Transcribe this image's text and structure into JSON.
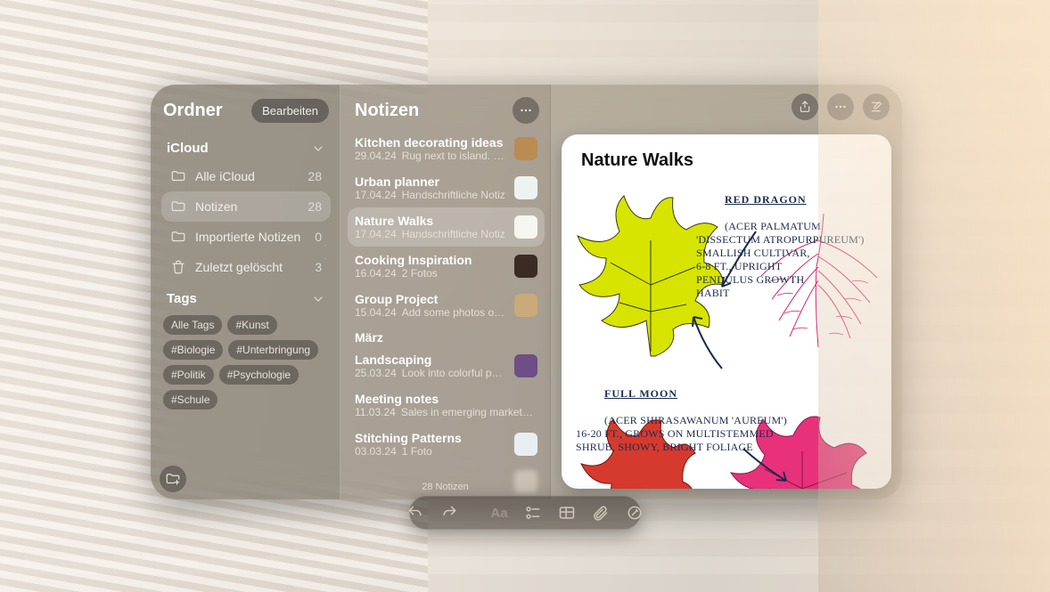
{
  "sidebar": {
    "title": "Ordner",
    "edit_label": "Bearbeiten",
    "section_label": "iCloud",
    "folders": [
      {
        "icon": "folder",
        "label": "Alle iCloud",
        "count": "28",
        "selected": false
      },
      {
        "icon": "folder",
        "label": "Notizen",
        "count": "28",
        "selected": true
      },
      {
        "icon": "folder",
        "label": "Importierte Notizen",
        "count": "0",
        "selected": false
      },
      {
        "icon": "trash",
        "label": "Zuletzt gelöscht",
        "count": "3",
        "selected": false
      }
    ],
    "tags_label": "Tags",
    "tags": [
      "Alle Tags",
      "#Kunst",
      "#Biologie",
      "#Unterbringung",
      "#Politik",
      "#Psychologie",
      "#Schule"
    ]
  },
  "mid": {
    "title": "Notizen",
    "sections": [
      {
        "label": null,
        "notes": [
          {
            "title": "Kitchen decorating ideas",
            "date": "29.04.24",
            "preview": "Rug next to island. Cont…",
            "thumb": "#b98c54",
            "selected": false
          },
          {
            "title": "Urban planner",
            "date": "17.04.24",
            "preview": "Handschriftliche Notiz",
            "thumb": "#eef2f1",
            "selected": false
          },
          {
            "title": "Nature Walks",
            "date": "17.04.24",
            "preview": "Handschriftliche Notiz",
            "thumb": "#f6f6f0",
            "selected": true
          },
          {
            "title": "Cooking Inspiration",
            "date": "16.04.24",
            "preview": "2 Fotos",
            "thumb": "#3b2b22",
            "selected": false
          },
          {
            "title": "Group Project",
            "date": "15.04.24",
            "preview": "Add some photos of thei…",
            "thumb": "#caa97a",
            "selected": false
          }
        ]
      },
      {
        "label": "März",
        "notes": [
          {
            "title": "Landscaping",
            "date": "25.03.24",
            "preview": "Look into colorful peren…",
            "thumb": "#6e4e86",
            "selected": false
          },
          {
            "title": "Meeting notes",
            "date": "11.03.24",
            "preview": "Sales in emerging markets are tr…",
            "thumb": null,
            "selected": false
          },
          {
            "title": "Stitching Patterns",
            "date": "03.03.24",
            "preview": "1 Foto",
            "thumb": "#e9eef2",
            "selected": false
          },
          {
            "title": "",
            "date": "",
            "preview": "",
            "thumb": "#d8cfc1",
            "selected": false,
            "blur": true
          }
        ]
      }
    ],
    "footer": "28 Notizen"
  },
  "detail": {
    "title": "Nature Walks",
    "annotations": {
      "a": "RED DRAGON\n(ACER PALMATUM 'DISSECTUM ATROPURPUREUM')\nSMALLISH CULTIVAR,\n6-8 FT., UPRIGHT\nPENDULUS GROWTH\nHABIT",
      "b": "FULL MOON\n(ACER SHIRASAWANUM 'AUREUM')\n16-20 FT., GROWS ON MULTISTEMMED\nSHRUB, SHOWY, BRIGHT FOLIAGE"
    }
  },
  "toolbar": {
    "items": [
      "undo",
      "redo",
      "sep",
      "font",
      "checklist",
      "table",
      "attach",
      "markup"
    ]
  }
}
